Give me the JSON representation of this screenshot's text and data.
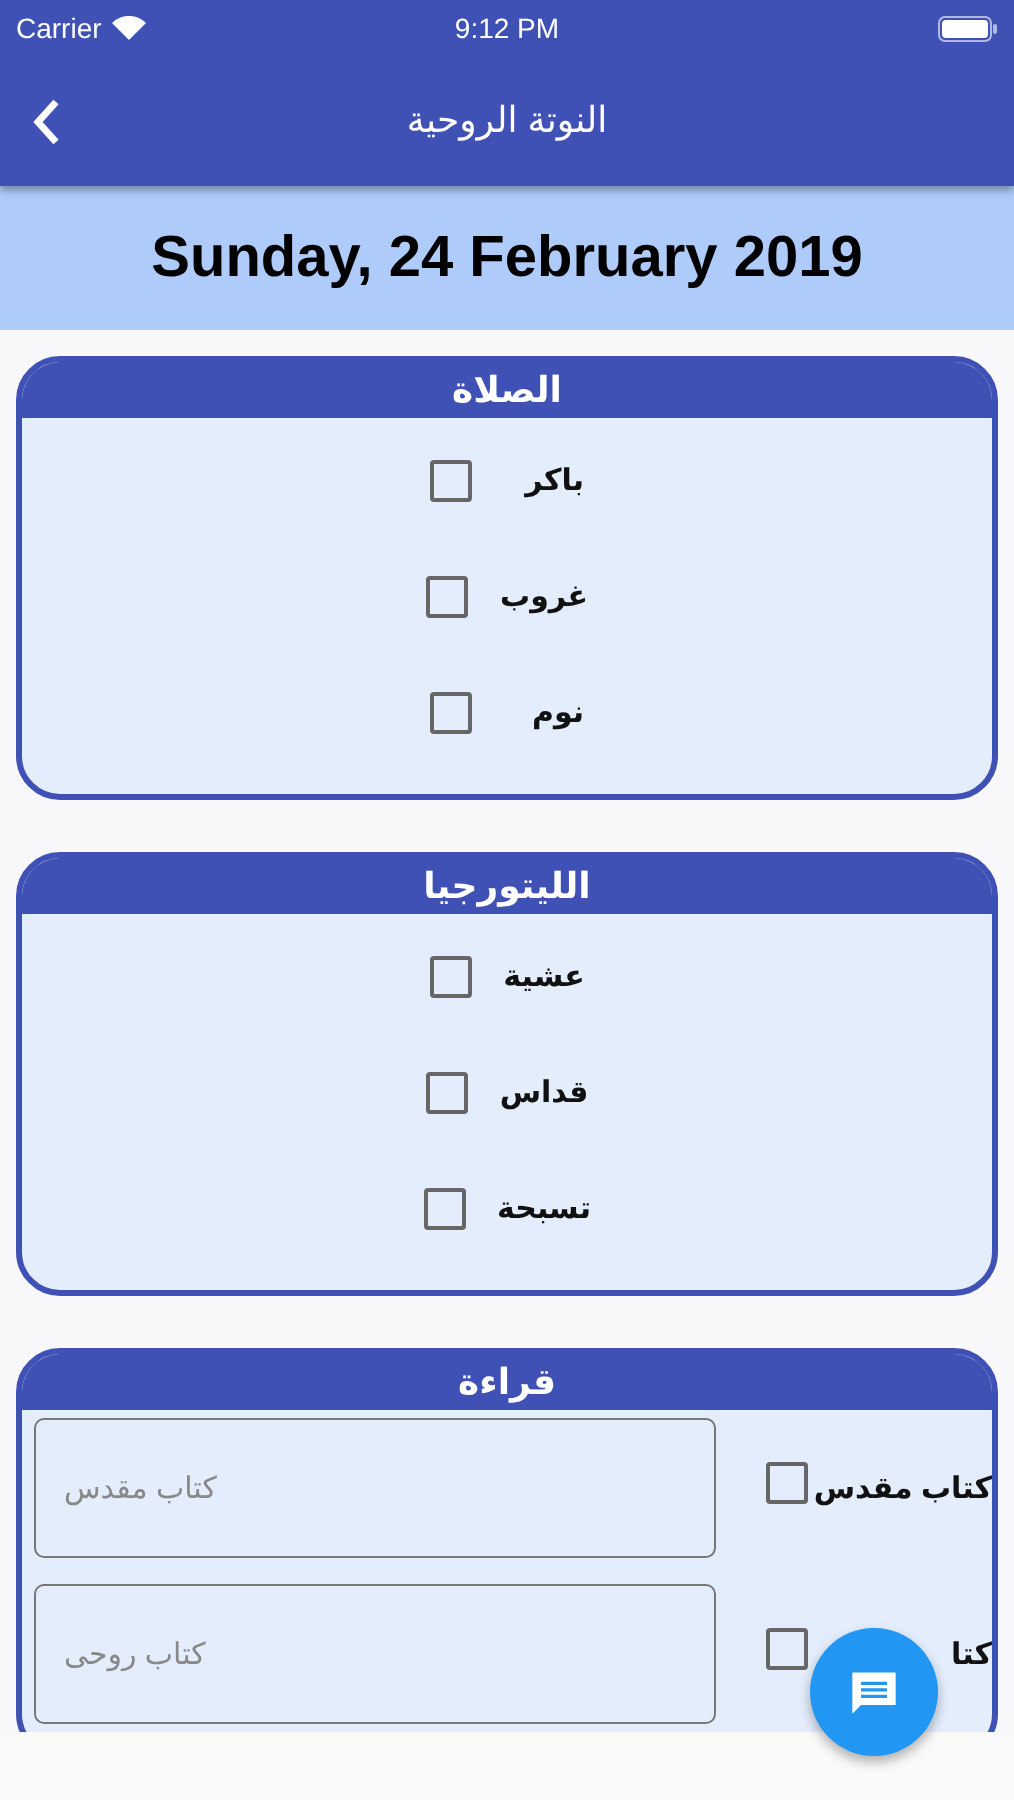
{
  "status_bar": {
    "carrier": "Carrier",
    "time": "9:12 PM"
  },
  "app_bar": {
    "title": "النوتة الروحية"
  },
  "date": "Sunday, 24 February 2019",
  "sections": [
    {
      "kind": "checklist",
      "title": "الصلاة",
      "items": [
        {
          "label": "باكر",
          "checked": false
        },
        {
          "label": "غروب",
          "checked": false
        },
        {
          "label": "نوم",
          "checked": false
        }
      ]
    },
    {
      "kind": "checklist",
      "title": "الليتورجيا",
      "items": [
        {
          "label": "عشية",
          "checked": false
        },
        {
          "label": "قداس",
          "checked": false
        },
        {
          "label": "تسبحة",
          "checked": false
        }
      ]
    },
    {
      "kind": "reading",
      "title": "قراءة",
      "items": [
        {
          "label": "كتاب مقدس",
          "checked": false,
          "placeholder": "كتاب مقدس"
        },
        {
          "label": "كتا",
          "checked": false,
          "placeholder": "كتاب روحى"
        }
      ]
    }
  ]
}
